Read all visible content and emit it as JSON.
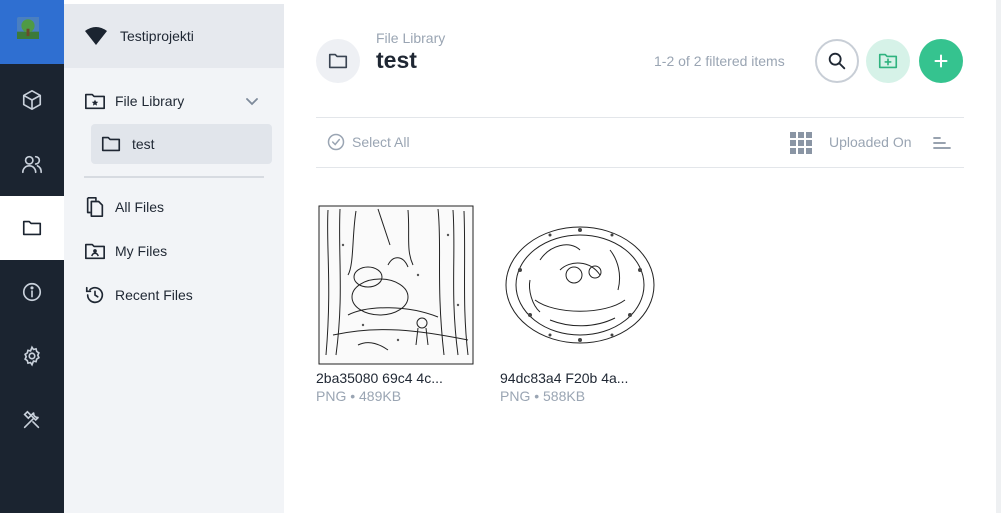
{
  "colors": {
    "rail": "#1b2430",
    "rail_active": "#ffffff",
    "logo_bg": "#2f6fd1",
    "sidebar": "#f2f4f7",
    "accent_green": "#35c38f",
    "muted": "#9aa5b3"
  },
  "rail": {
    "items": [
      {
        "icon": "logo-image"
      },
      {
        "icon": "cube-icon"
      },
      {
        "icon": "users-icon"
      },
      {
        "icon": "folder-icon",
        "active": true
      },
      {
        "icon": "info-icon"
      },
      {
        "icon": "gear-icon"
      },
      {
        "icon": "tools-icon"
      }
    ]
  },
  "sidebar": {
    "project_name": "Testiprojekti",
    "file_library": "File Library",
    "subfolder": "test",
    "all_files": "All Files",
    "my_files": "My Files",
    "recent_files": "Recent Files"
  },
  "main": {
    "breadcrumb": "File Library",
    "title": "test",
    "count_text": "1-2 of 2 filtered items",
    "select_all": "Select All",
    "sort_label": "Uploaded On"
  },
  "files": [
    {
      "name": "2ba35080 69c4 4c...",
      "meta": "PNG • 489KB",
      "thumb": "forest-sketch"
    },
    {
      "name": "94dc83a4 F20b 4a...",
      "meta": "PNG • 588KB",
      "thumb": "oval-sketch"
    }
  ]
}
